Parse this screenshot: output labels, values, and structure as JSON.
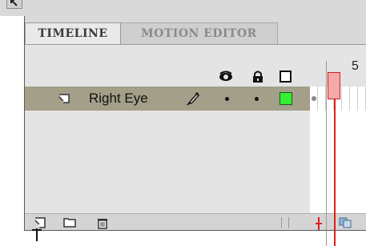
{
  "panel": {
    "tabs": [
      {
        "label": "TIMELINE",
        "active": true
      },
      {
        "label": "MOTION EDITOR",
        "active": false
      }
    ]
  },
  "header": {
    "icons": [
      "eye-icon",
      "lock-icon",
      "outline-icon"
    ],
    "frame_number": "5"
  },
  "layers": [
    {
      "name": "Right Eye",
      "visible_dot": true,
      "lock_dot": true,
      "outline_color": "#33ee33",
      "editing": true
    }
  ],
  "bottom_bar": {
    "icons": [
      "new-layer-icon",
      "new-folder-icon",
      "delete-icon",
      "center-frame-icon",
      "onion-skin-icon"
    ]
  },
  "colors": {
    "playhead": "#e02020",
    "layer_row": "#a39f88",
    "outline": "#33ee33"
  }
}
